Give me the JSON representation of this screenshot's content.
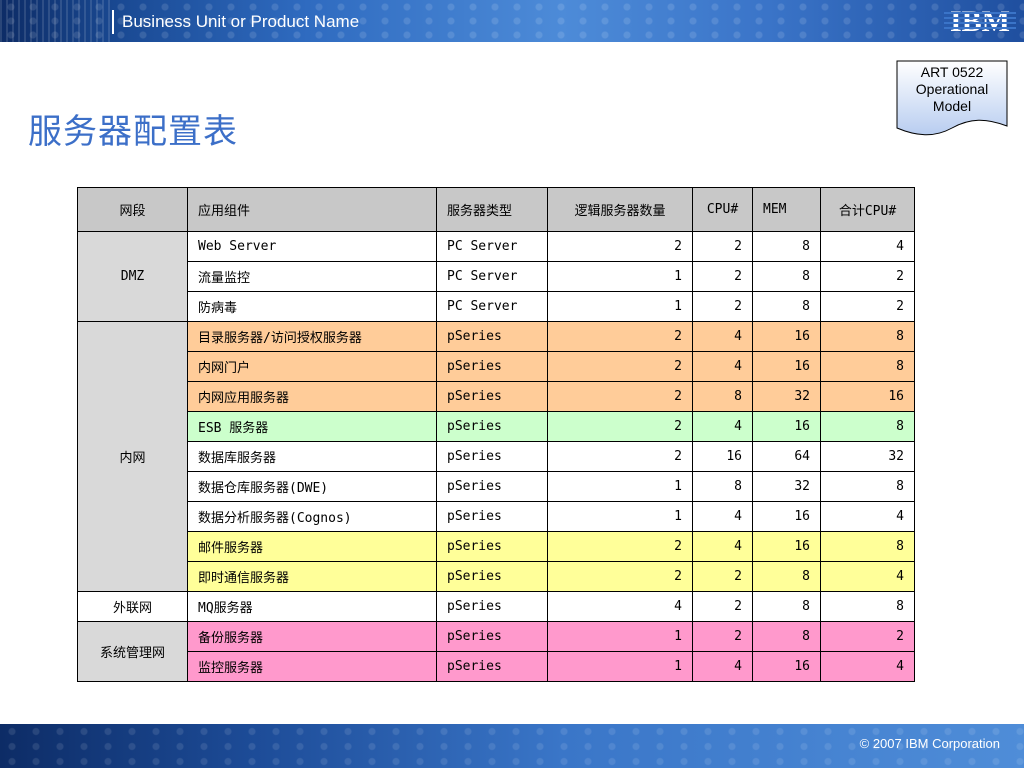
{
  "header": {
    "title": "Business Unit or Product Name",
    "logo_text": "IBM",
    "logo_icon": "ibm-logo-icon"
  },
  "page_title": "服务器配置表",
  "badge": {
    "icon": "document-icon",
    "lines": [
      "ART 0522",
      "Operational",
      "Model"
    ]
  },
  "table": {
    "headers": [
      "网段",
      "应用组件",
      "服务器类型",
      "逻辑服务器数量",
      "CPU#",
      "MEM",
      "合计CPU#"
    ],
    "segments": [
      "DMZ",
      "内网",
      "外联网",
      "系统管理网"
    ],
    "rows": [
      [
        "Web Server",
        "PC Server",
        "2",
        "2",
        "8",
        "4"
      ],
      [
        "流量监控",
        "PC Server",
        "1",
        "2",
        "8",
        "2"
      ],
      [
        "防病毒",
        "PC Server",
        "1",
        "2",
        "8",
        "2"
      ],
      [
        "目录服务器/访问授权服务器",
        "pSeries",
        "2",
        "4",
        "16",
        "8"
      ],
      [
        "内网门户",
        "pSeries",
        "2",
        "4",
        "16",
        "8"
      ],
      [
        "内网应用服务器",
        "pSeries",
        "2",
        "8",
        "32",
        "16"
      ],
      [
        "ESB 服务器",
        "pSeries",
        "2",
        "4",
        "16",
        "8"
      ],
      [
        "数据库服务器",
        "pSeries",
        "2",
        "16",
        "64",
        "32"
      ],
      [
        "数据仓库服务器(DWE)",
        "pSeries",
        "1",
        "8",
        "32",
        "8"
      ],
      [
        "数据分析服务器(Cognos)",
        "pSeries",
        "1",
        "4",
        "16",
        "4"
      ],
      [
        "邮件服务器",
        "pSeries",
        "2",
        "4",
        "16",
        "8"
      ],
      [
        "即时通信服务器",
        "pSeries",
        "2",
        "2",
        "8",
        "4"
      ],
      [
        "MQ服务器",
        "pSeries",
        "4",
        "2",
        "8",
        "8"
      ],
      [
        "备份服务器",
        "pSeries",
        "1",
        "2",
        "8",
        "2"
      ],
      [
        "监控服务器",
        "pSeries",
        "1",
        "4",
        "16",
        "4"
      ]
    ],
    "colors": {
      "header_bg": "#c8c8c8",
      "segment_bg": "#d9d9d9",
      "orange": "#ffcc99",
      "green": "#ccffcc",
      "yellow": "#ffff99",
      "pink": "#ff99cc"
    }
  },
  "footer": {
    "copyright": "© 2007 IBM Corporation"
  },
  "colors": {
    "title": "#3c6fc8",
    "band": "#1a4a94"
  }
}
